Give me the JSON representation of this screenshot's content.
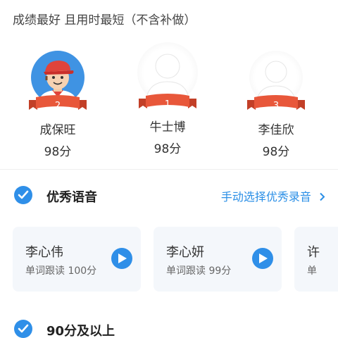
{
  "header": {
    "criteria": "成绩最好 且用时最短（不含补做）"
  },
  "podium": [
    {
      "rank": "2",
      "name": "成保旺",
      "score": "98分",
      "avatar": "cartoon-boy"
    },
    {
      "rank": "1",
      "name": "牛士博",
      "score": "98分",
      "avatar": "default-person"
    },
    {
      "rank": "3",
      "name": "李佳欣",
      "score": "98分",
      "avatar": "default-person"
    }
  ],
  "excellent_voice": {
    "title": "优秀语音",
    "manual_link": "手动选择优秀录音",
    "cards": [
      {
        "name": "李心伟",
        "detail": "单词跟读 100分"
      },
      {
        "name": "李心妍",
        "detail": "单词跟读 99分"
      },
      {
        "name": "许",
        "detail": "单"
      }
    ]
  },
  "above_90": {
    "title": "90分及以上"
  },
  "colors": {
    "accent": "#2f8fe8",
    "ribbon": "#e8573a"
  }
}
